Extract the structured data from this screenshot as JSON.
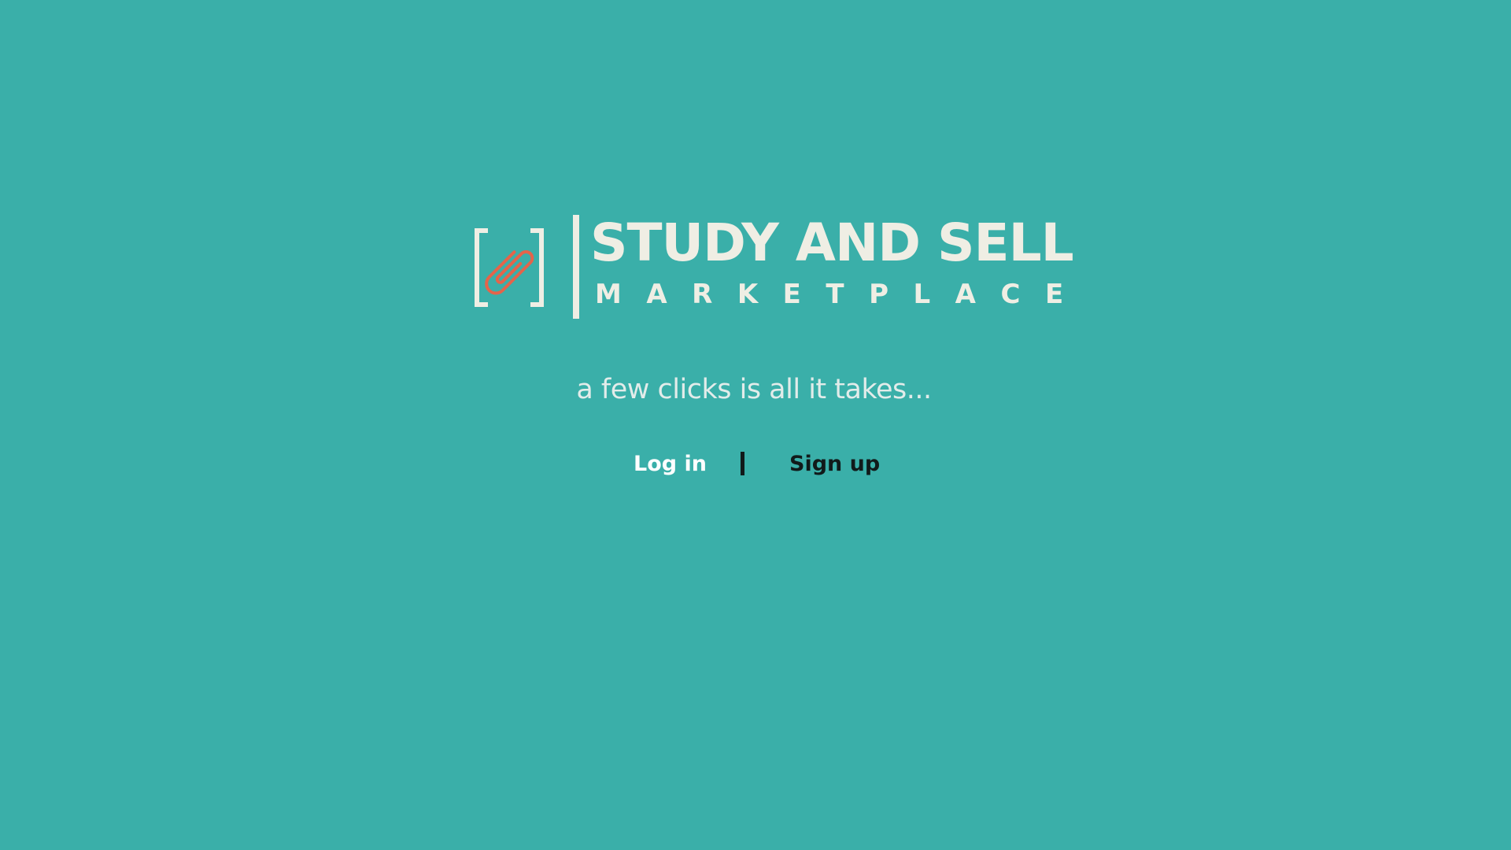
{
  "brand": {
    "title": "STUDY AND SELL",
    "subtitle": "MARKETPLACE",
    "logo_icon": "paperclip-in-brackets-icon"
  },
  "tagline": "a few clicks is all it takes...",
  "auth": {
    "login_label": "Log in",
    "signup_label": "Sign up"
  },
  "colors": {
    "background": "#3aafa9",
    "logo": "#efeee4",
    "paperclip": "#e4644a",
    "login_text": "#ffffff",
    "signup_text": "#111a1a"
  }
}
